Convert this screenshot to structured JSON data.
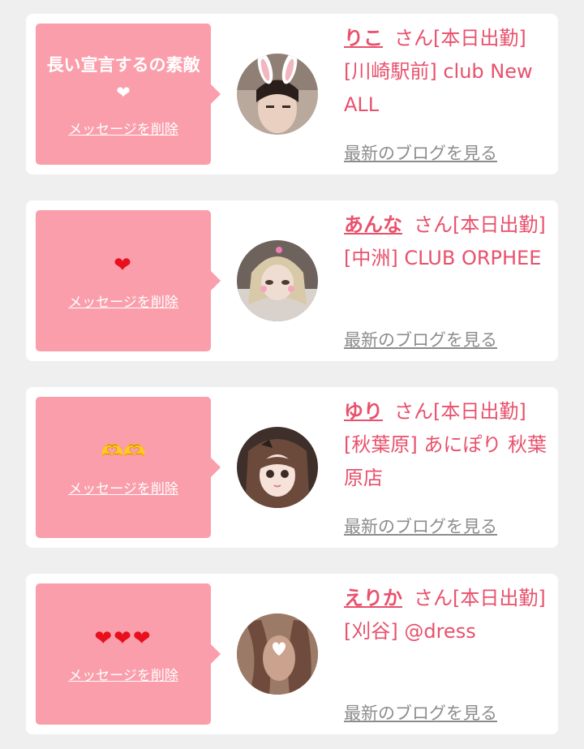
{
  "cards": [
    {
      "message": "長い宣言するの素敵❤",
      "delete_label": "メッセージを削除",
      "name": "りこ",
      "status": "さん[本日出勤]",
      "shop": "[川崎駅前] club New ALL",
      "blog_label": "最新のブログを見る"
    },
    {
      "message": "❤",
      "delete_label": "メッセージを削除",
      "name": "あんな",
      "status": "さん[本日出勤]",
      "shop": "[中洲] CLUB ORPHEE",
      "blog_label": "最新のブログを見る"
    },
    {
      "message": "🫶🫶",
      "delete_label": "メッセージを削除",
      "name": "ゆり",
      "status": "さん[本日出勤]",
      "shop": "[秋葉原] あにぽり 秋葉原店",
      "blog_label": "最新のブログを見る"
    },
    {
      "message": "❤❤❤",
      "delete_label": "メッセージを削除",
      "name": "えりか",
      "status": "さん[本日出勤]",
      "shop": "[刈谷] @dress",
      "blog_label": "最新のブログを見る"
    }
  ],
  "colors": {
    "bubble": "#fa9eab",
    "accent": "#e8516c",
    "link_gray": "#8c8c8c",
    "background": "#efefef"
  }
}
